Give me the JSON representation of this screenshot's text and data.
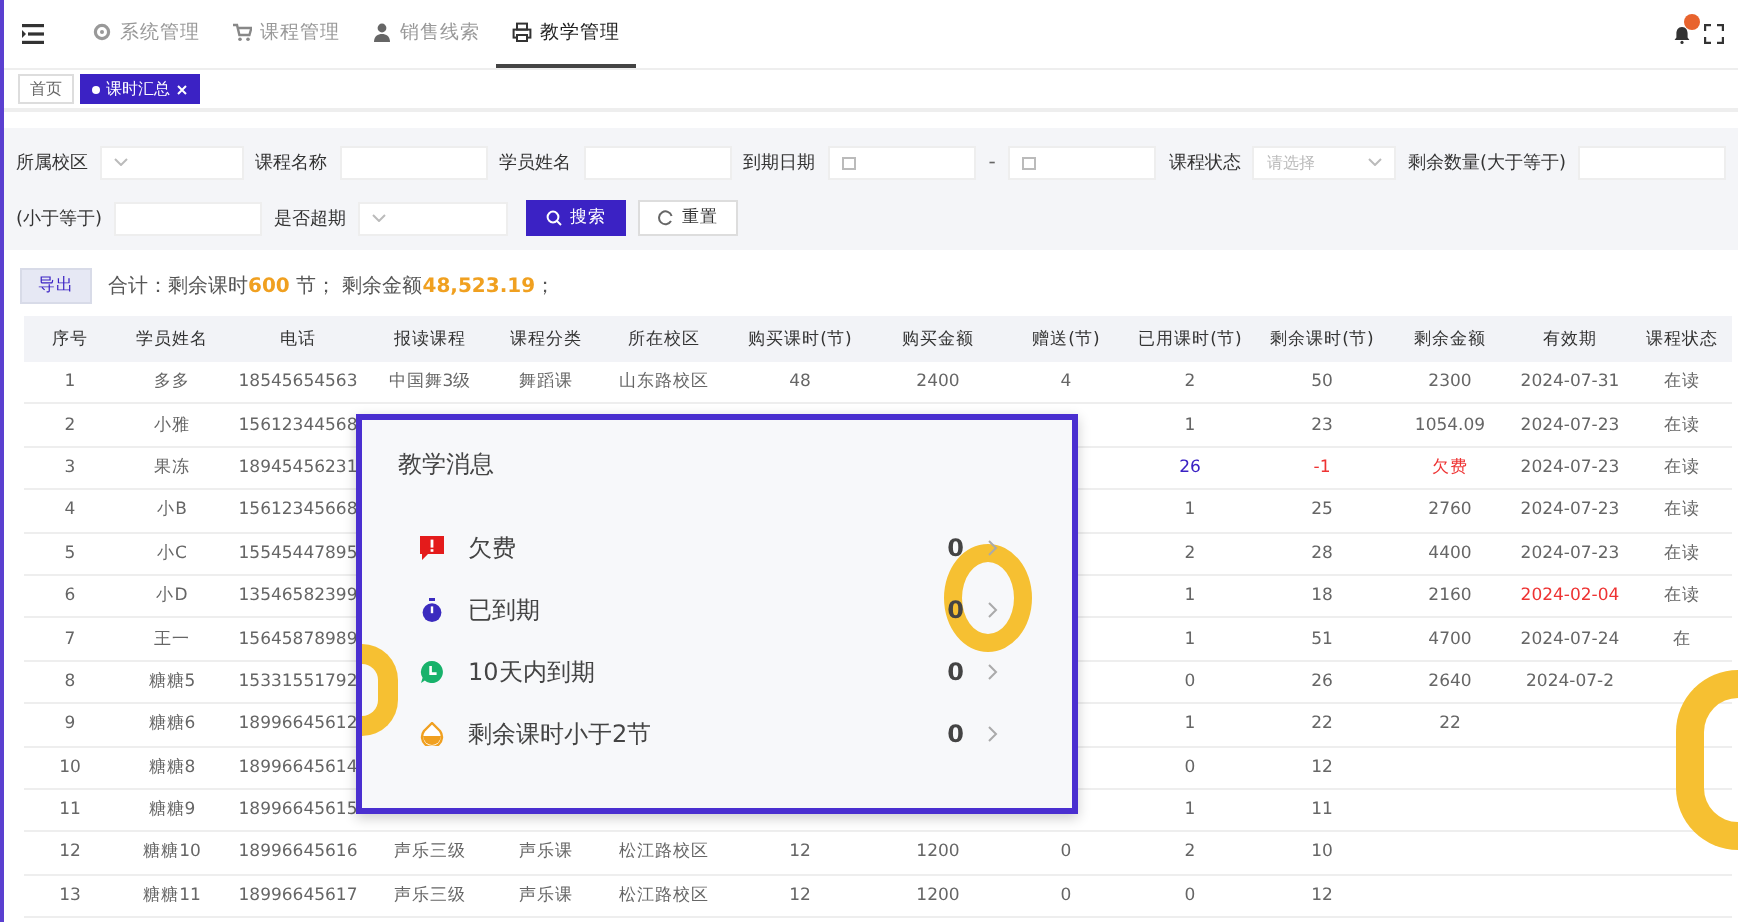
{
  "nav": {
    "items": [
      {
        "label": "系统管理",
        "kind": "gear",
        "selected": false
      },
      {
        "label": "课程管理",
        "kind": "cart",
        "selected": false
      },
      {
        "label": "销售线索",
        "kind": "person",
        "selected": false
      },
      {
        "label": "教学管理",
        "kind": "printer",
        "selected": true
      }
    ]
  },
  "tabs": [
    {
      "label": "首页",
      "selected": false,
      "closable": false
    },
    {
      "label": "课时汇总",
      "selected": true,
      "closable": true
    }
  ],
  "filters": {
    "rows": [
      [
        {
          "label": "所属校区",
          "kind": "select"
        },
        {
          "label": "课程名称",
          "kind": "text"
        },
        {
          "label": "学员姓名",
          "kind": "text"
        },
        {
          "label": "到期日期",
          "kind": "daterange",
          "separator": "-"
        },
        {
          "label": "课程状态",
          "kind": "select",
          "placeholder": "请选择"
        },
        {
          "label": "剩余数量(大于等于)",
          "kind": "text"
        }
      ],
      [
        {
          "label": "(小于等于)",
          "kind": "text"
        },
        {
          "label": "是否超期",
          "kind": "select"
        }
      ]
    ],
    "buttons": [
      {
        "label": "搜索",
        "kind": "primary"
      },
      {
        "label": "重置",
        "kind": "reset"
      }
    ]
  },
  "summary": {
    "export_button": "导出",
    "text": "合计：剩余课时**600** 节； 剩余金额**48,523.19**；"
  },
  "table": {
    "columns": [
      "序号",
      "学员姓名",
      "电话",
      "报读课程",
      "课程分类",
      "所在校区",
      "购买课时(节)",
      "购买金额",
      "赠送(节)",
      "已用课时(节)",
      "剩余课时(节)",
      "剩余金额",
      "有效期",
      "课程状态"
    ],
    "rows": [
      [
        "1",
        "多多",
        "18545654563",
        "中国舞3级",
        "舞蹈课",
        "山东路校区",
        "48",
        "2400",
        "4",
        "2",
        "50",
        "2300",
        "2024-07-31",
        "在读"
      ],
      [
        "2",
        "小雅",
        "15612344568",
        null,
        null,
        null,
        null,
        null,
        null,
        "1",
        "23",
        "1054.09",
        "2024-07-23",
        "在读"
      ],
      [
        "3",
        "果冻",
        "18945456231",
        null,
        null,
        null,
        null,
        null,
        null,
        {
          "text": "26",
          "kind": "link"
        },
        {
          "text": "-1",
          "kind": "warning"
        },
        {
          "text": "欠费",
          "kind": "warning"
        },
        "2024-07-23",
        "在读"
      ],
      [
        "4",
        "小B",
        "15612345668",
        null,
        null,
        null,
        null,
        null,
        null,
        "1",
        "25",
        "2760",
        "2024-07-23",
        "在读"
      ],
      [
        "5",
        "小C",
        "15545447895",
        null,
        null,
        null,
        null,
        null,
        null,
        "2",
        "28",
        "4400",
        "2024-07-23",
        "在读"
      ],
      [
        "6",
        "小D",
        "13546582399",
        null,
        null,
        null,
        null,
        null,
        null,
        "1",
        "18",
        "2160",
        {
          "text": "2024-02-04",
          "kind": "warning"
        },
        "在读"
      ],
      [
        "7",
        "王一",
        "15645878989",
        null,
        null,
        null,
        null,
        null,
        null,
        "1",
        "51",
        "4700",
        "2024-07-24",
        "在"
      ],
      [
        "8",
        "糖糖5",
        "15331551792",
        null,
        null,
        null,
        null,
        null,
        null,
        "0",
        "26",
        "2640",
        "2024-07-2",
        null
      ],
      [
        "9",
        "糖糖6",
        "18996645612",
        null,
        null,
        null,
        null,
        null,
        null,
        "1",
        "22",
        "22",
        null,
        null
      ],
      [
        "10",
        "糖糖8",
        "18996645614",
        null,
        null,
        null,
        null,
        null,
        null,
        "0",
        "12",
        null,
        null,
        null
      ],
      [
        "11",
        "糖糖9",
        "18996645615",
        null,
        null,
        null,
        null,
        null,
        null,
        "1",
        "11",
        null,
        null,
        null
      ],
      [
        "12",
        "糖糖10",
        "18996645616",
        "声乐三级",
        "声乐课",
        "松江路校区",
        "12",
        "1200",
        "0",
        "2",
        "10",
        null,
        null,
        null
      ],
      [
        "13",
        "糖糖11",
        "18996645617",
        "声乐三级",
        "声乐课",
        "松江路校区",
        "12",
        "1200",
        "0",
        "0",
        "12",
        null,
        null,
        null
      ]
    ]
  },
  "popup": {
    "title": "教学消息",
    "items": [
      {
        "label": "欠费",
        "kind": "arrears",
        "count": "0"
      },
      {
        "label": "已到期",
        "kind": "expired",
        "count": "0"
      },
      {
        "label": "10天内到期",
        "kind": "soon",
        "count": "0"
      },
      {
        "label": "剩余课时小于2节",
        "kind": "low",
        "count": "0"
      }
    ]
  }
}
